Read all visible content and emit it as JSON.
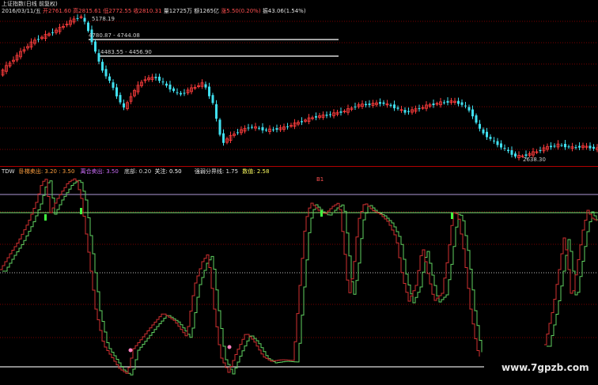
{
  "colors": {
    "up": "#ff3c3c",
    "down": "#40e0f0",
    "grid": "#7a0000",
    "axisLine": "#b00000",
    "level": "#d8d8d8",
    "purple": "#b09ad8",
    "green": "#78e878",
    "osc_green": "#60d060",
    "osc_red": "#d03030"
  },
  "header": {
    "title": "上证指数(日线 前复权)",
    "date": "2016/03/11/五",
    "open": "开2761.60",
    "high": "高2815.61",
    "low": "低2772.55",
    "close": "收2810.31",
    "volume": "量12725万",
    "amount": "额1265亿",
    "change": "涨5.50(0.20%)",
    "amplitude": "振43.06(1.54%)"
  },
  "price_labels": {
    "peak": "5178.19",
    "level1": "4780.87 - 4744.08",
    "level2": "4483.55 - 4456.90",
    "bottom": "2638.30"
  },
  "indicator": {
    "name": "TDW",
    "items": [
      {
        "label": "卧梯卖出: 3.20 : 3.50",
        "color": "#ffa040"
      },
      {
        "label": "离合卖出: 3.50",
        "color": "#d070ff"
      },
      {
        "label": "底部: 0.20",
        "color": "#d0d0d0"
      },
      {
        "label": "关注: 0.50",
        "color": "#ffffff"
      },
      {
        "label": "强弱分界线: 1.75",
        "color": "#e0e0e0"
      },
      {
        "label": "数值: 2.58",
        "color": "#ffff60"
      }
    ],
    "marker": "B1"
  },
  "watermark": "www.7gpzb.com"
}
